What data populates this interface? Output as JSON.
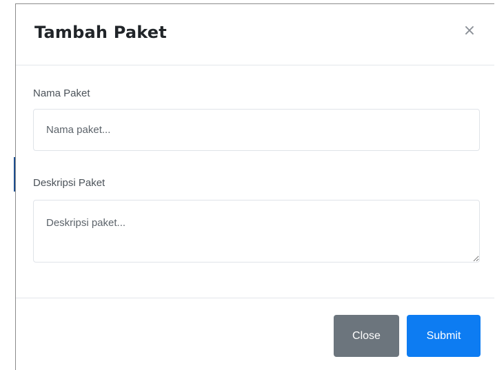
{
  "modal": {
    "title": "Tambah Paket",
    "close_symbol": "×",
    "close_icon": "close-icon"
  },
  "form": {
    "name": {
      "label": "Nama Paket",
      "placeholder": "Nama paket...",
      "value": ""
    },
    "description": {
      "label": "Deskripsi Paket",
      "placeholder": "Deskripsi paket...",
      "value": ""
    }
  },
  "footer": {
    "close_label": "Close",
    "submit_label": "Submit"
  },
  "colors": {
    "close_button": "#6c757d",
    "submit_button": "#0d7cf2",
    "accent_strip": "#1d4f8f"
  }
}
